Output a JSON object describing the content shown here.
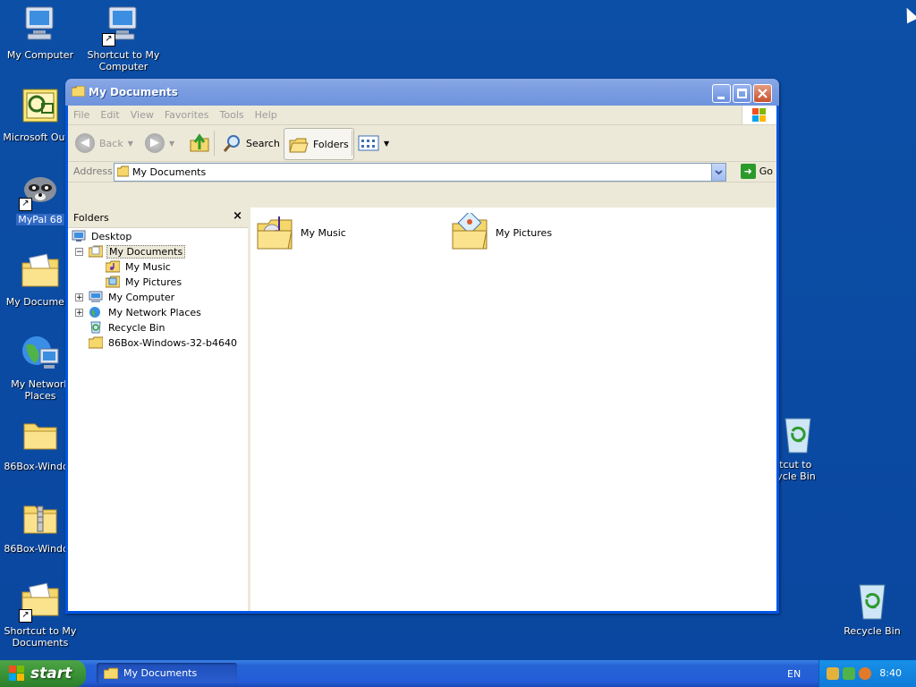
{
  "desktop": {
    "icons": [
      {
        "label": "My Computer"
      },
      {
        "label": "Shortcut to My\nComputer"
      },
      {
        "label": "Microsoft Outlo"
      },
      {
        "label": "MyPal 68"
      },
      {
        "label": "My Document"
      },
      {
        "label": "My Network\nPlaces"
      },
      {
        "label": "86Box-Window"
      },
      {
        "label": "86Box-Window"
      },
      {
        "label": "Shortcut to My\nDocuments"
      },
      {
        "label": "rtcut to\ncycle Bin"
      },
      {
        "label": "Recycle Bin"
      }
    ]
  },
  "window": {
    "title": "My Documents",
    "menu": [
      "File",
      "Edit",
      "View",
      "Favorites",
      "Tools",
      "Help"
    ],
    "toolbar": {
      "back": "Back",
      "search": "Search",
      "folders": "Folders"
    },
    "address": {
      "label": "Address",
      "value": "My Documents",
      "go": "Go"
    },
    "folders_panel": {
      "title": "Folders",
      "close": "×",
      "tree": [
        {
          "label": "Desktop"
        },
        {
          "label": "My Documents"
        },
        {
          "label": "My Music"
        },
        {
          "label": "My Pictures"
        },
        {
          "label": "My Computer"
        },
        {
          "label": "My Network Places"
        },
        {
          "label": "Recycle Bin"
        },
        {
          "label": "86Box-Windows-32-b4640"
        }
      ]
    },
    "content": {
      "items": [
        {
          "label": "My Music"
        },
        {
          "label": "My Pictures"
        }
      ]
    }
  },
  "taskbar": {
    "start": "start",
    "task": "My Documents",
    "language": "EN",
    "clock": "8:40"
  },
  "colors": {
    "desktop": "#0a4ba2",
    "titlebar": "#7b9ee2",
    "start": "#3a9437",
    "selection": "#316ac5"
  }
}
